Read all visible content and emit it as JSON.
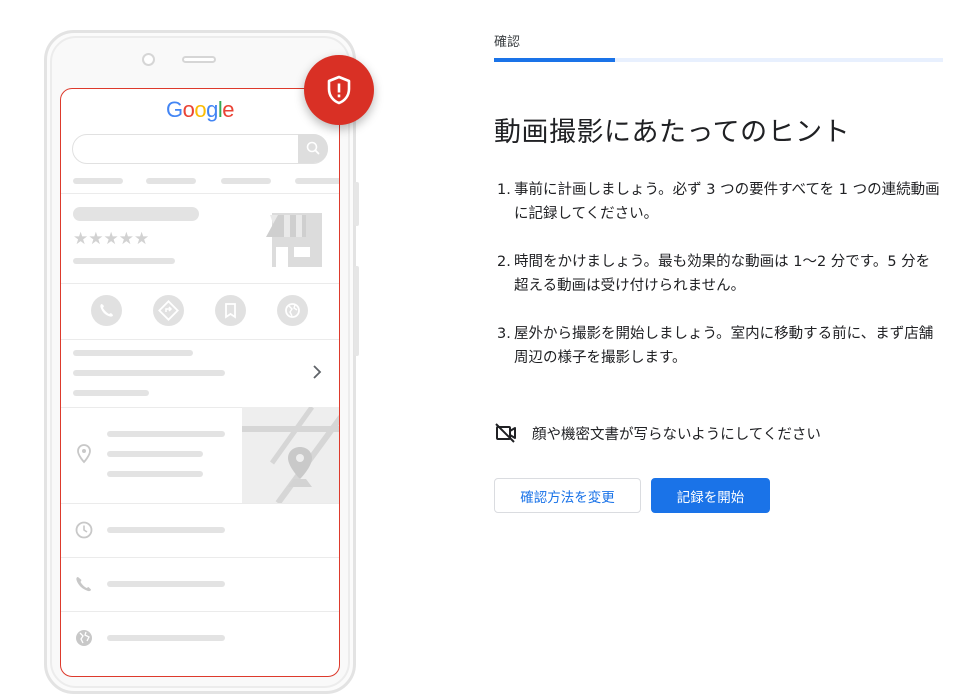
{
  "phone": {
    "logo": {
      "letters": [
        {
          "char": "G",
          "color": "#4285F4"
        },
        {
          "char": "o",
          "color": "#EA4335"
        },
        {
          "char": "o",
          "color": "#FBBC05"
        },
        {
          "char": "g",
          "color": "#4285F4"
        },
        {
          "char": "l",
          "color": "#34A853"
        },
        {
          "char": "e",
          "color": "#EA4335"
        }
      ]
    },
    "stars": "★★★★★",
    "badge_icon": "shield-alert-icon",
    "action_icons": [
      "phone-icon",
      "directions-icon",
      "bookmark-icon",
      "website-icon"
    ],
    "info_icons": [
      "location-pin-icon",
      "clock-icon",
      "phone-icon",
      "globe-icon"
    ]
  },
  "wizard": {
    "step_label": "確認",
    "progress": 0.27
  },
  "main": {
    "heading": "動画撮影にあたってのヒント",
    "tips": [
      {
        "number": "1.",
        "text": "事前に計画しましょう。必ず 3 つの要件すべてを 1 つの連続動画に記録してください。"
      },
      {
        "number": "2.",
        "text": "時間をかけましょう。最も効果的な動画は 1〜2 分です。5 分を超える動画は受け付けられません。"
      },
      {
        "number": "3.",
        "text": "屋外から撮影を開始しましょう。室内に移動する前に、まず店舗周辺の様子を撮影します。"
      }
    ],
    "notice": {
      "icon": "camera-off-icon",
      "text": "顔や機密文書が写らないようにしてください"
    }
  },
  "actions": {
    "secondary_label": "確認方法を変更",
    "primary_label": "記録を開始"
  },
  "colors": {
    "accent": "#1a73e8",
    "alert": "#d93025"
  }
}
